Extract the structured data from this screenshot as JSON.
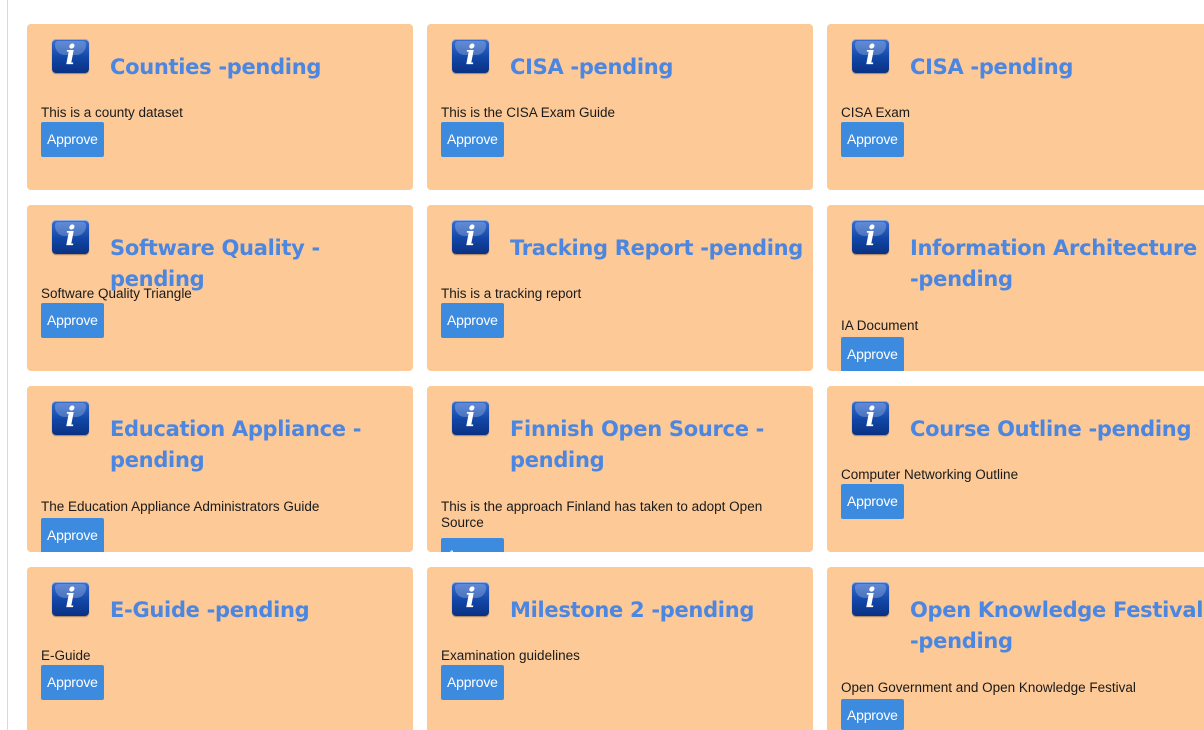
{
  "cards": [
    {
      "title": "Counties -pending",
      "description": "This is a county dataset",
      "button": "Approve"
    },
    {
      "title": "CISA -pending",
      "description": "This is the CISA Exam Guide",
      "button": "Approve"
    },
    {
      "title": "CISA -pending",
      "description": "CISA Exam",
      "button": "Approve"
    },
    {
      "title": "Software Quality -pending",
      "description": "Software Quality Triangle",
      "button": "Approve"
    },
    {
      "title": "Tracking Report -pending",
      "description": "This is a tracking report",
      "button": "Approve"
    },
    {
      "title": "Information Architecture -pending",
      "description": "IA Document",
      "button": "Approve"
    },
    {
      "title": "Education Appliance -pending",
      "description": "The Education Appliance Administrators Guide",
      "button": "Approve"
    },
    {
      "title": "Finnish Open Source -pending",
      "description": "This is the approach Finland has taken to adopt Open Source",
      "button": "Approve"
    },
    {
      "title": "Course Outline -pending",
      "description": "Computer Networking Outline",
      "button": "Approve"
    },
    {
      "title": "E-Guide -pending",
      "description": "E-Guide",
      "button": "Approve"
    },
    {
      "title": "Milestone 2 -pending",
      "description": "Examination guidelines",
      "button": "Approve"
    },
    {
      "title": "Open Knowledge Festival -pending",
      "description": "Open Government and Open Knowledge Festival",
      "button": "Approve"
    }
  ],
  "icon": {
    "name": "info-icon",
    "glyph": "i"
  },
  "colors": {
    "card_background": "#fcc997",
    "title": "#4b86e0",
    "button": "#3d8bdf",
    "icon": "#1146a6"
  }
}
